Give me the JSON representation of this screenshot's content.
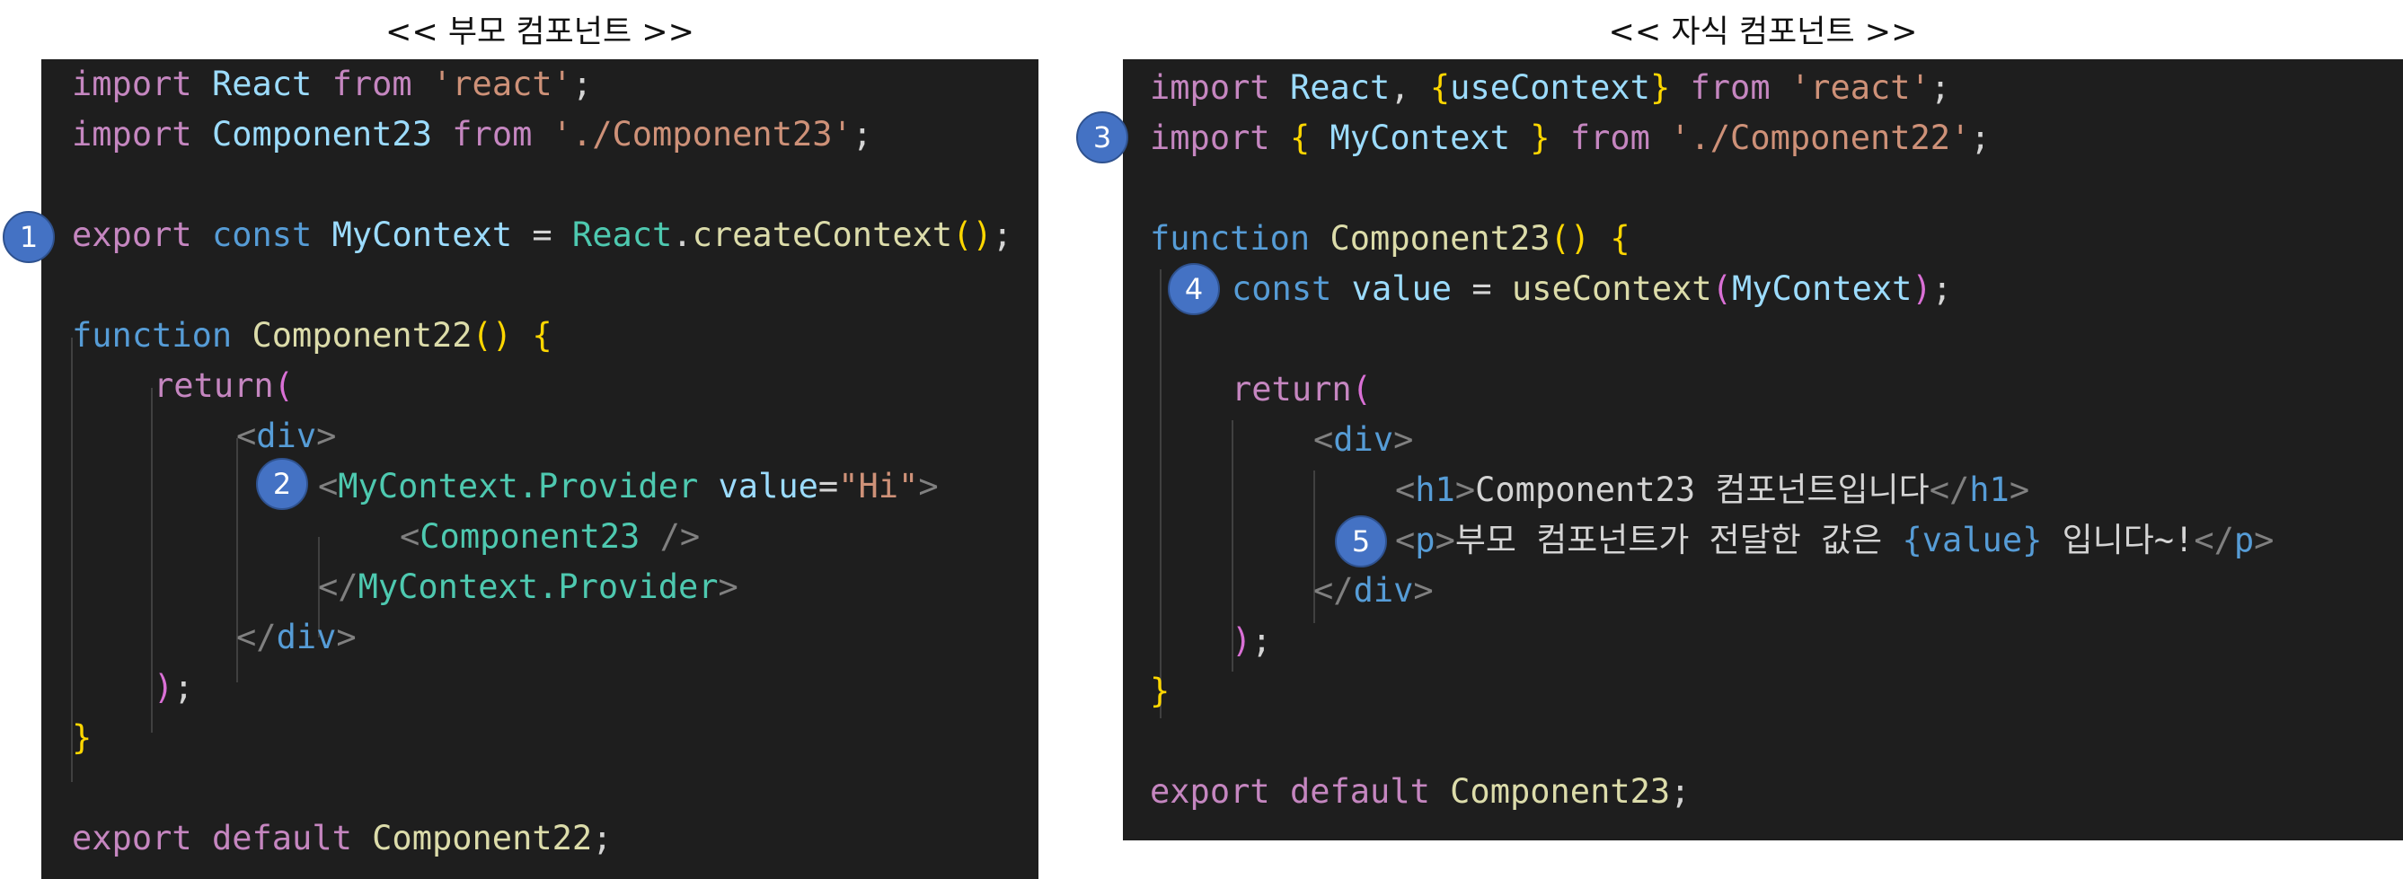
{
  "captions": {
    "parent": "<< 부모 컴포넌트 >>",
    "child": "<< 자식 컴포넌트 >>"
  },
  "badges": {
    "b1": "1",
    "b2": "2",
    "b3": "3",
    "b4": "4",
    "b5": "5"
  },
  "parent_code": {
    "l1": [
      "import",
      "React",
      "from",
      "'react'",
      ";"
    ],
    "l2": [
      "import",
      "Component23",
      "from",
      "'./Component23'",
      ";"
    ],
    "l4": [
      "export",
      "const",
      "MyContext",
      " = ",
      "React",
      ".",
      "createContext",
      "(",
      ")",
      ";"
    ],
    "l6": [
      "function",
      "Component22",
      "(",
      ")",
      "{"
    ],
    "l7": [
      "return",
      "("
    ],
    "l8": [
      "<",
      "div",
      ">"
    ],
    "l9": [
      "<",
      "MyContext.Provider",
      "value",
      "=",
      "\"Hi\"",
      ">"
    ],
    "l10": [
      "<",
      "Component23",
      "/>"
    ],
    "l11": [
      "</",
      "MyContext.Provider",
      ">"
    ],
    "l12": [
      "</",
      "div",
      ">"
    ],
    "l13": [
      ")",
      ";"
    ],
    "l14": [
      "}"
    ],
    "l16": [
      "export",
      "default",
      "Component22",
      ";"
    ]
  },
  "child_code": {
    "l1": [
      "import",
      "React",
      ", ",
      "{",
      "useContext",
      "}",
      "from",
      "'react'",
      ";"
    ],
    "l2": [
      "import",
      "{",
      "MyContext",
      "}",
      "from",
      "'./Component22'",
      ";"
    ],
    "l4": [
      "function",
      "Component23",
      "(",
      ")",
      "{"
    ],
    "l5": [
      "const",
      "value",
      " = ",
      "useContext",
      "(",
      "MyContext",
      ")",
      ";"
    ],
    "l7": [
      "return",
      "("
    ],
    "l8": [
      "<",
      "div",
      ">"
    ],
    "l9": [
      "<",
      "h1",
      ">",
      "Component23 컴포넌트입니다",
      "</",
      "h1",
      ">"
    ],
    "l10": [
      "<",
      "p",
      ">",
      "부모 컴포넌트가 전달한 값은 ",
      "{value}",
      " 입니다~!",
      "</",
      "p",
      ">"
    ],
    "l11": [
      "</",
      "div",
      ">"
    ],
    "l12": [
      ")",
      ";"
    ],
    "l13": [
      "}"
    ],
    "l15": [
      "export",
      "default",
      "Component23",
      ";"
    ]
  }
}
